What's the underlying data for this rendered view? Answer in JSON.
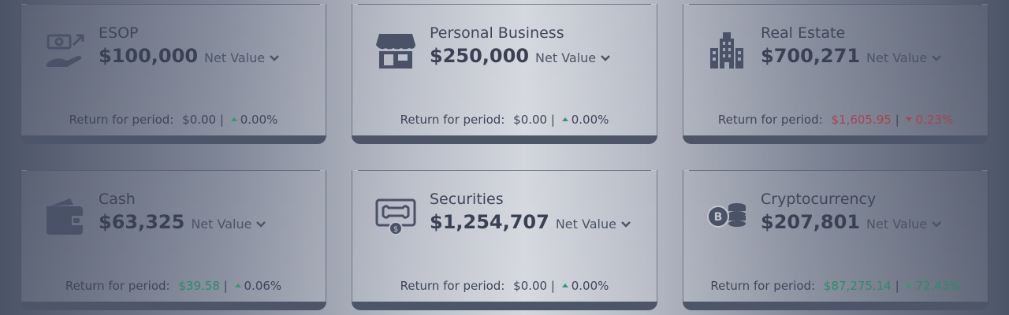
{
  "cards": [
    {
      "title": "ESOP",
      "amount": "$100,000",
      "net_label": "Net Value",
      "return_label": "Return for period:",
      "return_amount": "$0.00",
      "sep": "|",
      "return_pct": "0.00%",
      "trend": "up",
      "icon": "stock-options-icon"
    },
    {
      "title": "Personal Business",
      "amount": "$250,000",
      "net_label": "Net Value",
      "return_label": "Return for period:",
      "return_amount": "$0.00",
      "sep": "|",
      "return_pct": "0.00%",
      "trend": "up",
      "icon": "storefront-icon"
    },
    {
      "title": "Real Estate",
      "amount": "$700,271",
      "net_label": "Net Value",
      "return_label": "Return for period:",
      "return_amount": "$1,605.95",
      "sep": "|",
      "return_pct": "0.23%",
      "trend": "down",
      "icon": "building-icon"
    },
    {
      "title": "Cash",
      "amount": "$63,325",
      "net_label": "Net Value",
      "return_label": "Return for period:",
      "return_amount": "$39.58",
      "sep": "|",
      "return_pct": "0.06%",
      "trend": "up",
      "icon": "wallet-icon"
    },
    {
      "title": "Securities",
      "amount": "$1,254,707",
      "net_label": "Net Value",
      "return_label": "Return for period:",
      "return_amount": "$0.00",
      "sep": "|",
      "return_pct": "0.00%",
      "trend": "up",
      "icon": "certificate-icon"
    },
    {
      "title": "Cryptocurrency",
      "amount": "$207,801",
      "net_label": "Net Value",
      "return_label": "Return for period:",
      "return_amount": "$87,275.14",
      "sep": "|",
      "return_pct": "72.43%",
      "trend": "up",
      "icon": "crypto-coins-icon"
    }
  ],
  "colors": {
    "positive": "#2f8a68",
    "negative": "#a4454d",
    "bar": "#4d5669"
  }
}
